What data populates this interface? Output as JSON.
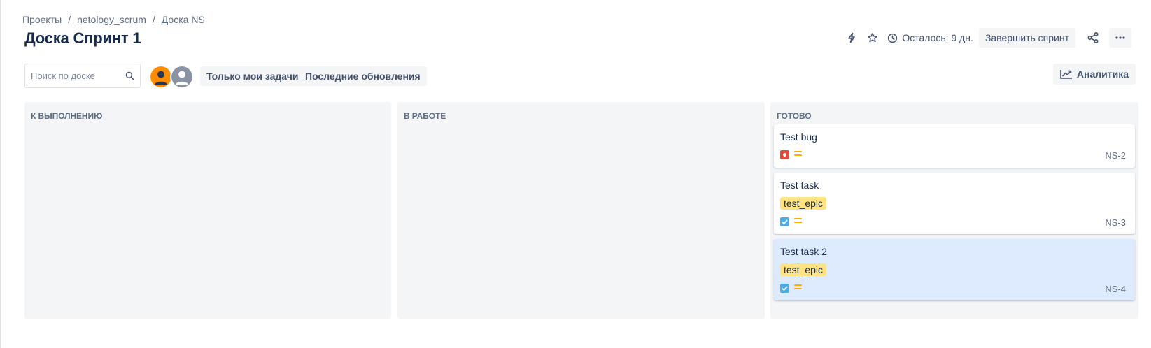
{
  "breadcrumb": [
    "Проекты",
    "netology_scrum",
    "Доска NS"
  ],
  "breadcrumb_separator": "/",
  "page_title": "Доска Спринт 1",
  "header": {
    "time_left": "Осталось: 9 дн.",
    "complete_sprint": "Завершить спринт"
  },
  "toolbar": {
    "search_placeholder": "Поиск по доске",
    "only_my_issues": "Только мои задачи",
    "recent_updates": "Последние обновления",
    "analytics": "Аналитика"
  },
  "colors": {
    "bug": "#e5493a",
    "task": "#4bade8",
    "priority_medium": "#ffab00",
    "epic_tag": "#ffe380",
    "selected_card": "#deebff"
  },
  "columns": [
    {
      "title": "К выполнению",
      "cards": []
    },
    {
      "title": "В работе",
      "cards": []
    },
    {
      "title": "Готово",
      "cards": [
        {
          "title": "Test bug",
          "type": "bug",
          "priority": "medium",
          "key": "NS-2"
        },
        {
          "title": "Test task",
          "epic": "test_epic",
          "type": "task",
          "priority": "medium",
          "key": "NS-3"
        },
        {
          "title": "Test task 2",
          "epic": "test_epic",
          "type": "task",
          "priority": "medium",
          "key": "NS-4",
          "selected": true
        }
      ]
    }
  ]
}
